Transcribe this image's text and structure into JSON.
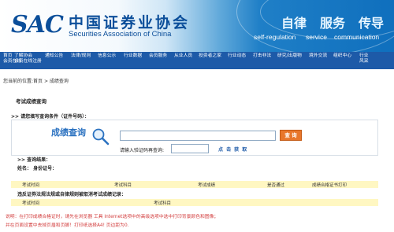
{
  "header": {
    "logo": "SAC",
    "cn_name": "中国证券业协会",
    "en_name": "Securities Association of China",
    "mottos": [
      {
        "cn": "自律",
        "en": "self-regulation"
      },
      {
        "cn": "服务",
        "en": "service"
      },
      {
        "cn": "传导",
        "en": "communication"
      }
    ]
  },
  "nav": [
    [
      "首页",
      "会员在线"
    ],
    [
      "了解协会",
      "会员在线注册"
    ],
    [
      "通知公告",
      ""
    ],
    [
      "法律/规则",
      ""
    ],
    [
      "信息公示",
      ""
    ],
    [
      "行业数据",
      ""
    ],
    [
      "会员服务",
      ""
    ],
    [
      "从业人员",
      ""
    ],
    [
      "投资者之家",
      ""
    ],
    [
      "行业动态",
      ""
    ],
    [
      "打击非法",
      ""
    ],
    [
      "研究/出版物",
      ""
    ],
    [
      "境外交流",
      ""
    ],
    [
      "组织中心",
      ""
    ],
    [
      "行业",
      "风采"
    ]
  ],
  "breadcrumb": {
    "prefix": "您当前的位置:",
    "home": "首页",
    "sep": ">",
    "current": "成绩查询"
  },
  "page_title": "考试成绩查询",
  "query": {
    "condition_label": ">> 请您填写查询条件（证件号码）：",
    "heading": "成绩查询",
    "id_value": "",
    "button": "查 询",
    "captcha_label": "请输入验证码再查询:",
    "captcha_value": "",
    "captcha_text": "点 击 获 取"
  },
  "results": {
    "label": ">> 查询结果：",
    "name_label": "姓名：",
    "id_label": "身份证号："
  },
  "exam_table": {
    "headers": [
      "考试时间",
      "考试科目",
      "考试成绩",
      "是否通过",
      "成绩合格证书打印"
    ]
  },
  "violation": {
    "label": "违反证券法规法规或自律规则被取消考试成绩记录：",
    "headers": [
      "考试时间",
      "考试科目"
    ]
  },
  "notes": [
    "说明：在打印成绩合格证时，请先在浏览器 工具 Internet选项中的高级选项中选中打印背景颜色和图像；",
    "并在页面设置中去掉页眉和页脚！打印纸选择A4! 页边距为0."
  ]
}
